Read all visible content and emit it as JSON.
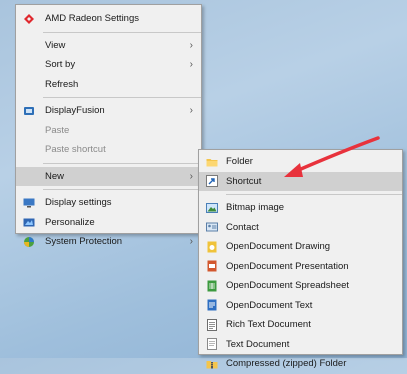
{
  "context_menu": {
    "items": [
      {
        "label": "AMD Radeon Settings",
        "icon": "amd-radeon-icon"
      },
      {
        "label": "View"
      },
      {
        "label": "Sort by"
      },
      {
        "label": "Refresh"
      },
      {
        "label": "DisplayFusion",
        "icon": "displayfusion-icon"
      },
      {
        "label": "Paste"
      },
      {
        "label": "Paste shortcut"
      },
      {
        "label": "New"
      },
      {
        "label": "Display settings",
        "icon": "display-settings-icon"
      },
      {
        "label": "Personalize",
        "icon": "personalize-icon"
      },
      {
        "label": "System Protection",
        "icon": "system-protection-icon"
      }
    ]
  },
  "new_submenu": {
    "items": [
      {
        "label": "Folder",
        "icon": "folder-icon"
      },
      {
        "label": "Shortcut",
        "icon": "shortcut-icon"
      },
      {
        "label": "Bitmap image",
        "icon": "bitmap-icon"
      },
      {
        "label": "Contact",
        "icon": "contact-icon"
      },
      {
        "label": "OpenDocument Drawing",
        "icon": "odg-icon"
      },
      {
        "label": "OpenDocument Presentation",
        "icon": "odp-icon"
      },
      {
        "label": "OpenDocument Spreadsheet",
        "icon": "ods-icon"
      },
      {
        "label": "OpenDocument Text",
        "icon": "odt-icon"
      },
      {
        "label": "Rich Text Document",
        "icon": "rtf-icon"
      },
      {
        "label": "Text Document",
        "icon": "txt-icon"
      },
      {
        "label": "Compressed (zipped) Folder",
        "icon": "zip-folder-icon"
      }
    ]
  },
  "colors": {
    "menu_bg": "#f0f0f0",
    "highlight": "#d0d0d0",
    "annotation_arrow": "#e8323c"
  }
}
